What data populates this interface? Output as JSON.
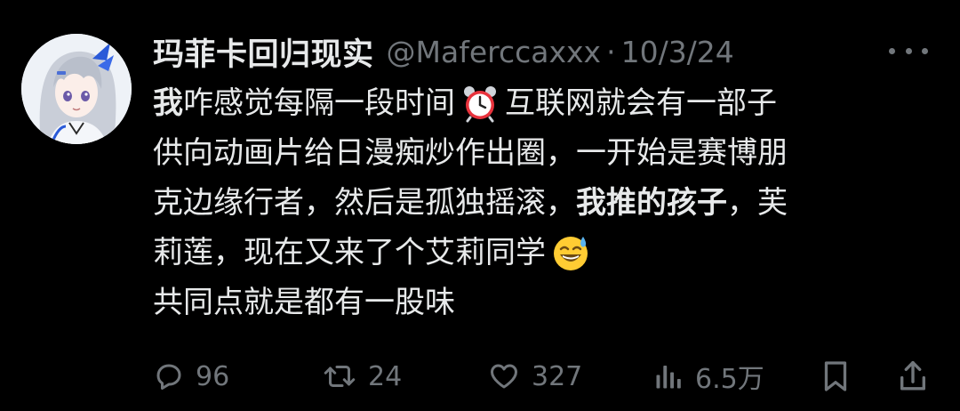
{
  "author": {
    "display_name": "玛菲卡回归现实",
    "handle": "@Maferccaxxx",
    "separator": "·",
    "date": "10/3/24"
  },
  "tweet": {
    "lines": [
      {
        "parts": [
          {
            "text": "我",
            "bold": true
          },
          {
            "text": "咋感觉每隔一段时间",
            "bold": false
          },
          {
            "emoji": "alarm-clock-emoji"
          },
          {
            "text": "互联网就会有一部子",
            "bold": false
          }
        ]
      },
      {
        "parts": [
          {
            "text": "供向动画片给日漫痴炒作出圈，一开始是赛博朋",
            "bold": false
          }
        ]
      },
      {
        "parts": [
          {
            "text": "克边缘行者，然后是孤独摇滚，",
            "bold": false
          },
          {
            "text": "我推的孩子",
            "bold": true
          },
          {
            "text": "，芙",
            "bold": false
          }
        ]
      },
      {
        "parts": [
          {
            "text": "莉莲，现在又来了个艾莉同学",
            "bold": false
          },
          {
            "emoji": "sweat-smile-emoji"
          }
        ]
      },
      {
        "parts": [
          {
            "text": "共同点就是都有一股味",
            "bold": false
          }
        ]
      }
    ]
  },
  "actions": {
    "reply_count": "96",
    "repost_count": "24",
    "like_count": "327",
    "views_count": "6.5万"
  },
  "icons": {
    "reply": "reply-icon",
    "repost": "repost-icon",
    "like": "heart-icon",
    "views": "views-icon",
    "bookmark": "bookmark-icon",
    "share": "share-icon",
    "more": "more-icon"
  },
  "colors": {
    "background": "#000000",
    "text_primary": "#e7e9ea",
    "text_secondary": "#71767b"
  }
}
